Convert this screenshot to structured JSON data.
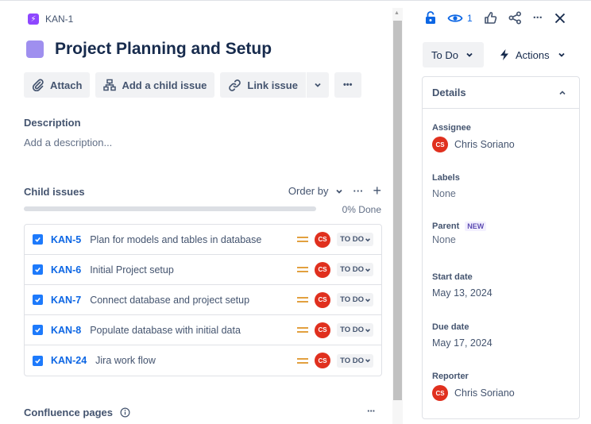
{
  "issue": {
    "key": "KAN-1",
    "title": "Project Planning and Setup"
  },
  "actions": {
    "attach": "Attach",
    "add_child": "Add a child issue",
    "link": "Link issue",
    "more": "•••"
  },
  "description": {
    "heading": "Description",
    "placeholder": "Add a description..."
  },
  "child_issues": {
    "heading": "Child issues",
    "order_by": "Order by",
    "more": "···",
    "add": "+",
    "progress_pct": 0,
    "progress_text": "0% Done",
    "items": [
      {
        "key": "KAN-5",
        "summary": "Plan for models and tables in database",
        "avatar": "CS",
        "status": "TO DO"
      },
      {
        "key": "KAN-6",
        "summary": "Initial Project setup",
        "avatar": "CS",
        "status": "TO DO"
      },
      {
        "key": "KAN-7",
        "summary": "Connect database and project setup",
        "avatar": "CS",
        "status": "TO DO"
      },
      {
        "key": "KAN-8",
        "summary": "Populate database with initial data",
        "avatar": "CS",
        "status": "TO DO"
      },
      {
        "key": "KAN-24",
        "summary": "Jira work flow",
        "avatar": "CS",
        "status": "TO DO"
      }
    ]
  },
  "confluence": {
    "heading": "Confluence pages",
    "more": "···"
  },
  "topbar": {
    "watch_count": "1"
  },
  "status_button": "To Do",
  "actions_button": "Actions",
  "details": {
    "heading": "Details",
    "assignee_label": "Assignee",
    "assignee_initials": "CS",
    "assignee_name": "Chris Soriano",
    "labels_label": "Labels",
    "labels_value": "None",
    "parent_label": "Parent",
    "parent_badge": "NEW",
    "parent_value": "None",
    "start_label": "Start date",
    "start_value": "May 13, 2024",
    "due_label": "Due date",
    "due_value": "May 17, 2024",
    "reporter_label": "Reporter",
    "reporter_initials": "CS",
    "reporter_name": "Chris Soriano"
  },
  "colors": {
    "accent": "#0c66e4",
    "epic": "#8e47ff",
    "title_square": "#9f8fef",
    "avatar": "#e0301e",
    "priority": "#e2a03f"
  }
}
